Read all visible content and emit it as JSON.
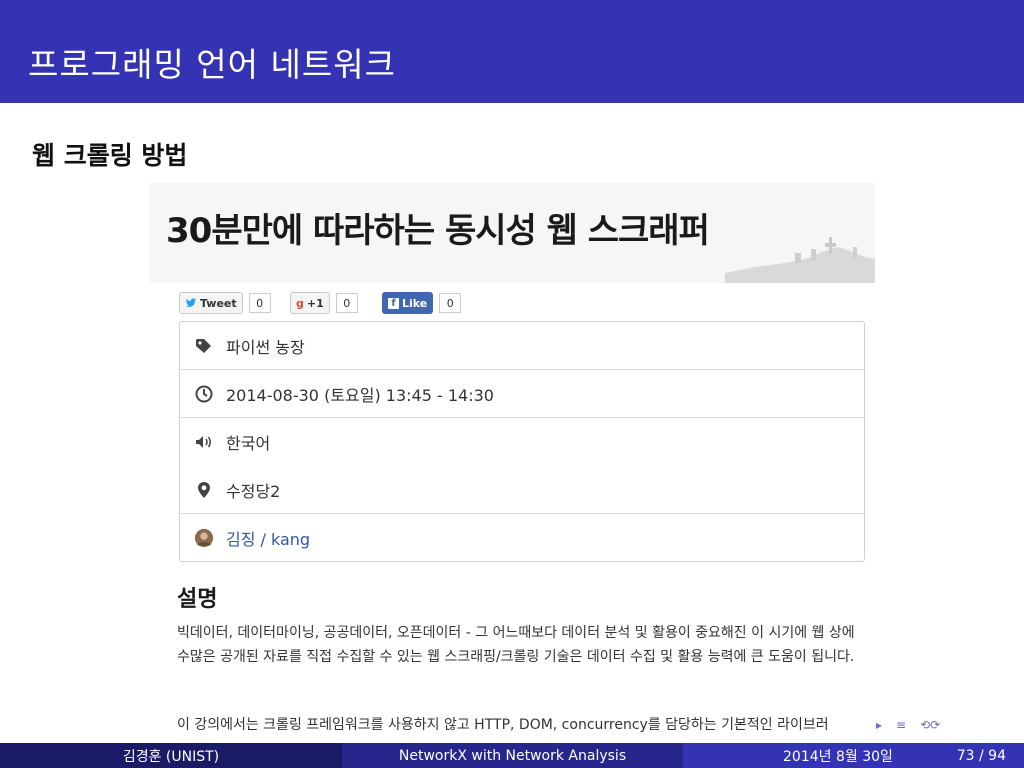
{
  "slide": {
    "frame_title": "프로그래밍 언어 네트워크",
    "subtitle": "웹 크롤링 방법"
  },
  "screenshot": {
    "banner_title": "30분만에 따라하는 동시성 웹 스크래퍼",
    "social": {
      "tweet_label": "Tweet",
      "tweet_count": "0",
      "gplus_label": "+1",
      "gplus_count": "0",
      "like_label": "Like",
      "like_count": "0"
    },
    "info_rows": [
      {
        "icon": "tag-icon",
        "text": "파이썬 농장"
      },
      {
        "icon": "clock-icon",
        "text": "2014-08-30 (토요일) 13:45 - 14:30"
      },
      {
        "icon": "speaker-icon",
        "text": "한국어"
      },
      {
        "icon": "map-pin-icon",
        "text": "수정당2"
      },
      {
        "icon": "avatar",
        "text": "김징 / kang"
      }
    ],
    "description_heading": "설명",
    "description_text": "빅데이터, 데이터마이닝, 공공데이터, 오픈데이터 - 그 어느때보다 데이터 분석 및 활용이 중요해진 이 시기에 웹 상에 수많은 공개된 자료를 직접 수집할 수 있는 웹 스크래핑/크롤링 기술은 데이터 수집 및 활용 능력에 큰 도움이 됩니다.",
    "description_text_2": "이 강의에서는 크롤링 프레임워크를 사용하지 않고 HTTP, DOM, concurrency를 담당하는 기본적인 라이브러"
  },
  "footer": {
    "author": "김경훈  (UNIST)",
    "title": "NetworkX with Network Analysis",
    "date": "2014년 8월 30일",
    "page": "73 / 94"
  },
  "colors": {
    "title_bar": "#3333b3",
    "footer_left": "#1a1a66",
    "footer_mid": "#26268c",
    "footer_right": "#3333b3"
  }
}
